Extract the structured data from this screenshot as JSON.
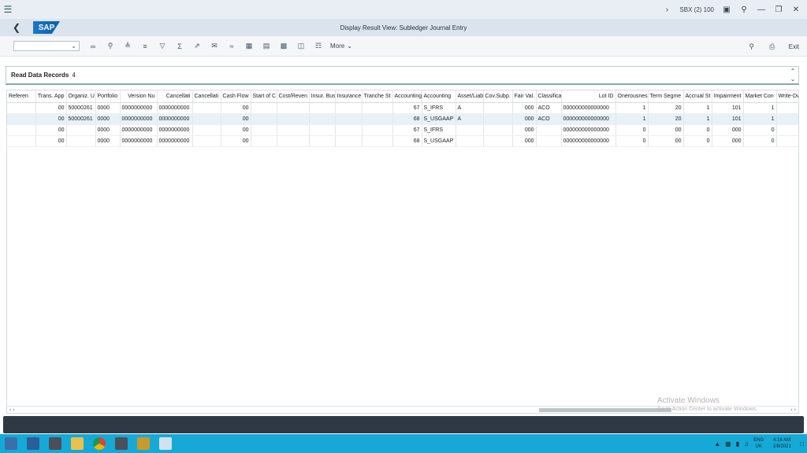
{
  "system": {
    "session": "SBX (2) 100",
    "icons": [
      "menu-icon",
      "chevron-right-icon",
      "window-icon",
      "lock-icon",
      "minimize-icon",
      "restore-icon",
      "close-icon"
    ]
  },
  "header": {
    "logo": "SAP",
    "title": "Display Result View: Subledger Journal Entry"
  },
  "toolbar": {
    "more_label": "More",
    "exit_label": "Exit"
  },
  "records": {
    "label": "Read Data Records",
    "count": "4"
  },
  "table": {
    "columns": [
      "Referen",
      "Trans. App",
      "Organiz. U",
      "Portfolio",
      "Version Nu",
      "Cancellati",
      "Cancellati",
      "Cash Flow",
      "Start of C",
      "Cost/Reven",
      "Insur. Bus",
      "Insurance",
      "Tranche St",
      "Accounting",
      "Accounting",
      "Asset/Liab",
      "Cov.Subp.",
      "Fair Val.",
      "Classifica",
      "Lot ID",
      "Onerousnes",
      "Term Segme",
      "Accrual St",
      "Impairment",
      "Market Con",
      "Write-Dw"
    ],
    "rows": [
      [
        "",
        "00",
        "50000261",
        "0000",
        "0000000000",
        "0000000000",
        "",
        "00",
        "",
        "",
        "",
        "",
        "",
        "67",
        "S_IFRS",
        "A",
        "",
        "000",
        "ACO",
        "000000000000000",
        "1",
        "20",
        "1",
        "101",
        "1",
        ""
      ],
      [
        "",
        "00",
        "50000261",
        "0000",
        "0000000000",
        "0000000000",
        "",
        "00",
        "",
        "",
        "",
        "",
        "",
        "68",
        "S_USGAAP",
        "A",
        "",
        "000",
        "ACO",
        "000000000000000",
        "1",
        "20",
        "1",
        "101",
        "1",
        ""
      ],
      [
        "",
        "00",
        "",
        "0000",
        "0000000000",
        "0000000000",
        "",
        "00",
        "",
        "",
        "",
        "",
        "",
        "67",
        "S_IFRS",
        "",
        "",
        "000",
        "",
        "000000000000000",
        "0",
        "00",
        "0",
        "000",
        "0",
        ""
      ],
      [
        "",
        "00",
        "",
        "0000",
        "0000000000",
        "0000000000",
        "",
        "00",
        "",
        "",
        "",
        "",
        "",
        "68",
        "S_USGAAP",
        "",
        "",
        "000",
        "",
        "000000000000000",
        "0",
        "00",
        "0",
        "000",
        "0",
        ""
      ]
    ],
    "selected_row": 1
  },
  "watermark": {
    "line1": "Activate Windows",
    "line2": "Go to Action Center to activate Windows."
  },
  "taskbar": {
    "lang_line1": "ENG",
    "lang_line2": "UK",
    "time": "4:16 AM",
    "date": "1/8/2021"
  }
}
